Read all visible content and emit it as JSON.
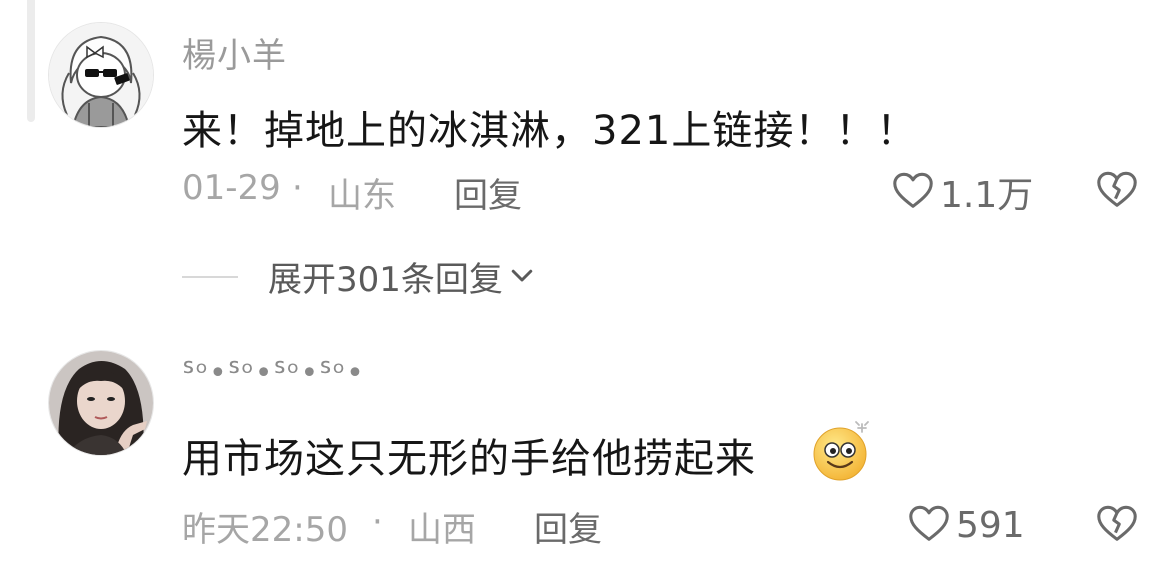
{
  "comments": [
    {
      "username": "楊小羊",
      "text": "来！掉地上的冰淇淋，321上链接！！！",
      "date": "01-29",
      "separator": "·",
      "location": "山东",
      "reply_label": "回复",
      "likes": "1.1万",
      "expand_label": "展开301条回复"
    },
    {
      "username": "ᔆᵒ•ᔆᵒ•ᔆᵒ•ᔆᵒ•",
      "text": "用市场这只无形的手给他捞起来",
      "emoji_icon": "smile-emoji",
      "date": "昨天22:50",
      "separator": "·",
      "location": "山西",
      "reply_label": "回复",
      "likes": "591"
    }
  ],
  "icons": {
    "like": "heart-outline-icon",
    "dislike": "broken-heart-icon",
    "expand": "chevron-down-icon"
  },
  "colors": {
    "text_primary": "#161616",
    "text_secondary": "#a6a6a6",
    "action": "#6a6a6a"
  }
}
